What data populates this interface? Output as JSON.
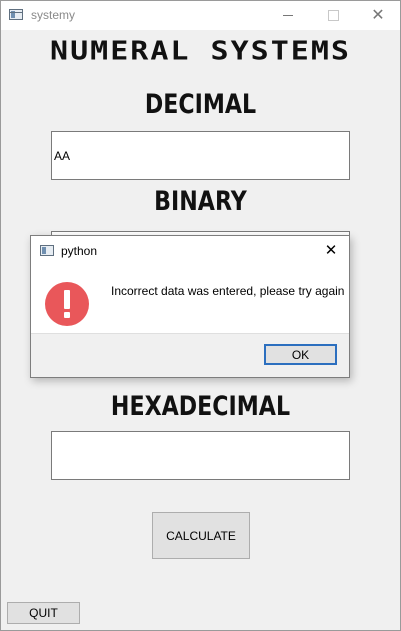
{
  "window": {
    "title": "systemy",
    "close_glyph": "✕"
  },
  "main": {
    "heading": "NUMERAL SYSTEMS",
    "decimal_label": "DECIMAL",
    "decimal_value": "AA",
    "binary_label": "BINARY",
    "binary_value": "",
    "hexadecimal_label": "HEXADECIMAL",
    "hexadecimal_value": "",
    "calculate_label": "CALCULATE",
    "quit_label": "QUIT"
  },
  "dialog": {
    "title": "python",
    "close_glyph": "✕",
    "message": "Incorrect data was entered, please try again",
    "ok_label": "OK",
    "icon": "error-icon"
  },
  "colors": {
    "error_red": "#e9575a",
    "ok_focus_border": "#2c6fbf",
    "background": "#f0f0f0"
  }
}
